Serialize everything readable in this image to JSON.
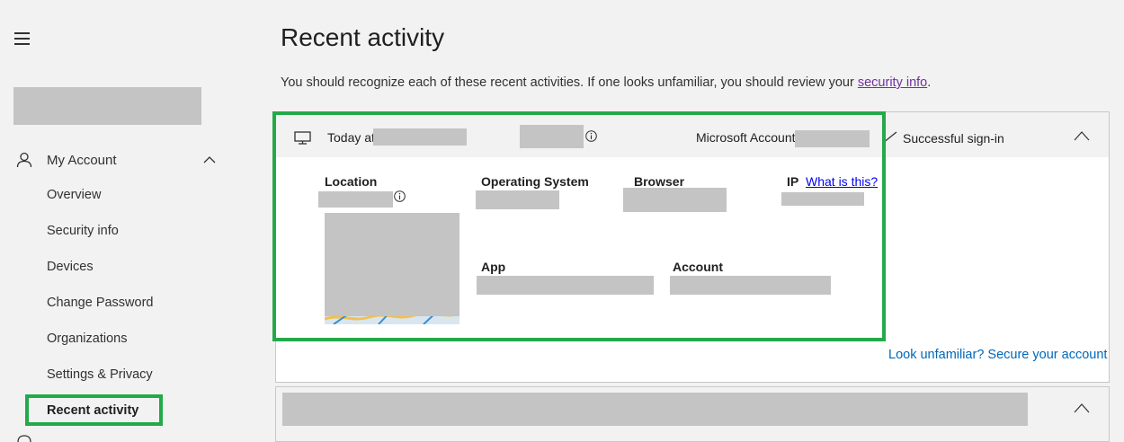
{
  "sidebar": {
    "section_label": "My Account",
    "items": [
      {
        "label": "Overview"
      },
      {
        "label": "Security info"
      },
      {
        "label": "Devices"
      },
      {
        "label": "Change Password"
      },
      {
        "label": "Organizations"
      },
      {
        "label": "Settings & Privacy"
      },
      {
        "label": "Recent activity"
      }
    ]
  },
  "main": {
    "title": "Recent activity",
    "intro_text": "You should recognize each of these recent activities. If one looks unfamiliar, you should review your ",
    "intro_link": "security info",
    "intro_end": "."
  },
  "activity": {
    "today_at": "Today at",
    "app_name": "Microsoft Account",
    "status": "Successful sign-in",
    "labels": {
      "location": "Location",
      "os": "Operating System",
      "browser": "Browser",
      "ip": "IP",
      "what_is_this": "What is this?",
      "app": "App",
      "account": "Account"
    },
    "secure_link": "Look unfamiliar? Secure your account"
  },
  "colors": {
    "highlight": "#24a94a",
    "link": "#0067b8",
    "visited_link": "#7030a0"
  }
}
